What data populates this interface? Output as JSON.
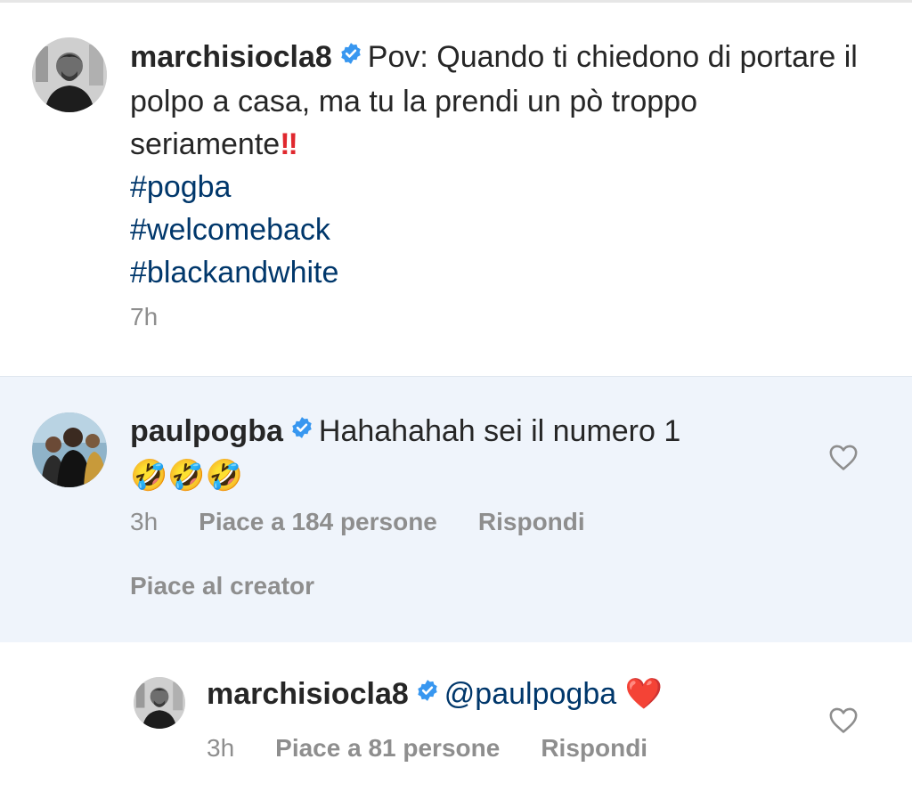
{
  "caption": {
    "username": "marchisiocla8",
    "text": "Pov: Quando ti chiedono di portare il polpo a casa, ma tu la prendi un pò troppo seriamente",
    "emoji": "‼️",
    "hashtags": [
      "#pogba",
      "#welcomeback",
      "#blackandwhite"
    ],
    "time": "7h"
  },
  "comment": {
    "username": "paulpogba",
    "text": "Hahahahah sei il numero 1",
    "emojis": "🤣🤣🤣",
    "time": "3h",
    "likes": "Piace a 184 persone",
    "reply": "Rispondi",
    "creator_like": "Piace al creator"
  },
  "reply": {
    "username": "marchisiocla8",
    "mention": "@paulpogba",
    "emoji": "❤️",
    "time": "3h",
    "likes": "Piace a 81 persone",
    "reply": "Rispondi"
  },
  "icons": {
    "verified": "verified-badge-icon",
    "like": "heart-outline-icon"
  },
  "colors": {
    "hashtag": "#00376b",
    "verified": "#3897f0",
    "highlight_bg": "#eff4fb",
    "muted": "#8e8e8e"
  }
}
